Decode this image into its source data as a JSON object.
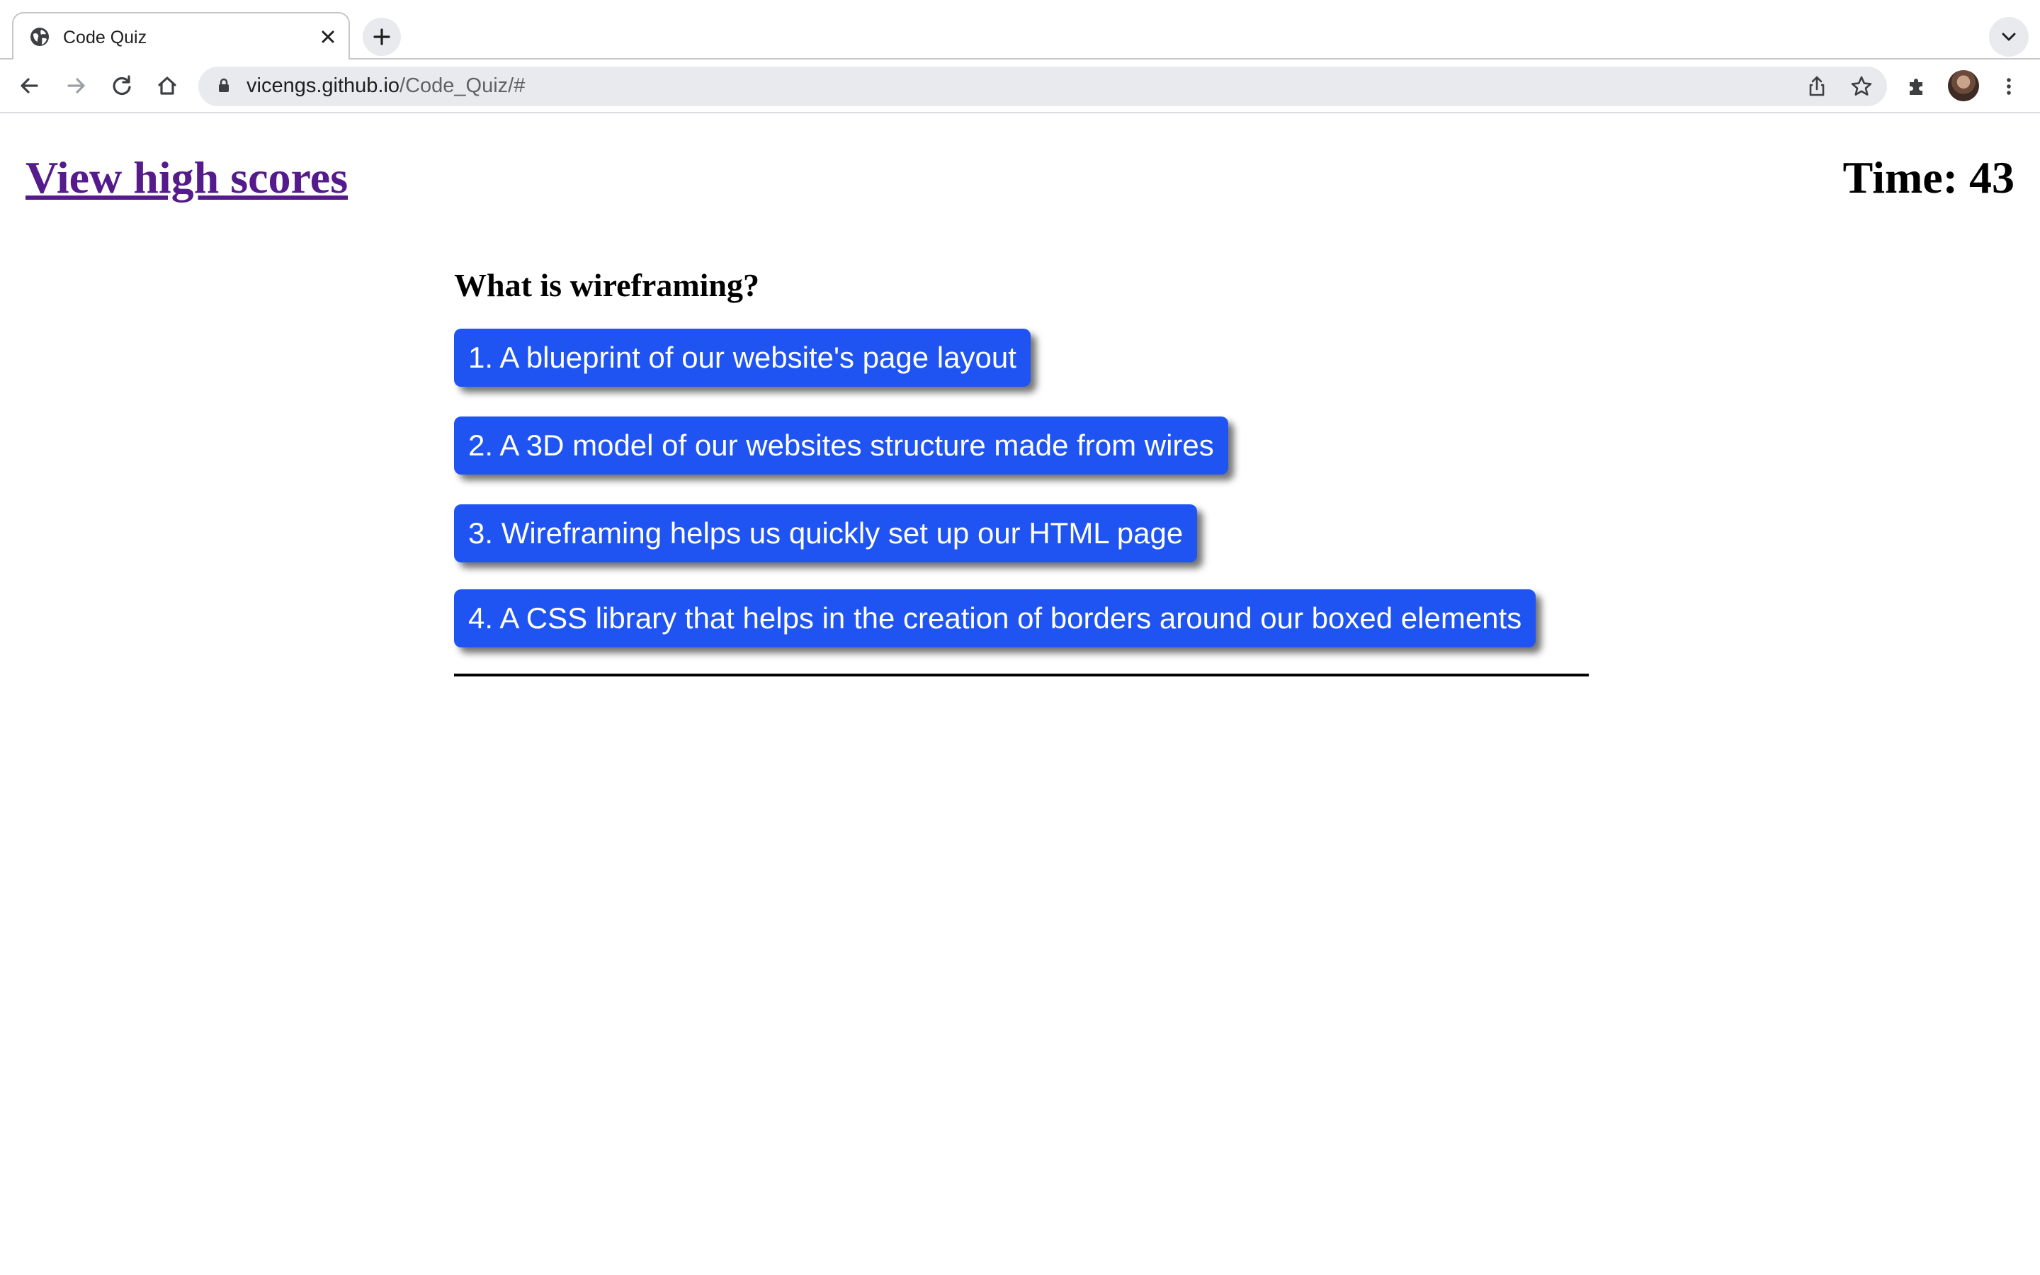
{
  "browser": {
    "tab": {
      "title": "Code Quiz"
    },
    "address_bar": {
      "host": "vicengs.github.io",
      "path": "/Code_Quiz/#"
    }
  },
  "page": {
    "high_scores_link": "View high scores",
    "timer": {
      "label": "Time: 43",
      "seconds_remaining": 43
    },
    "quiz": {
      "question": "What is wireframing?",
      "answers": [
        "1. A blueprint of our website's page layout",
        "2. A 3D model of our websites structure made from wires",
        "3. Wireframing helps us quickly set up our HTML page",
        "4. A CSS library that helps in the creation of borders around our boxed elements"
      ]
    }
  },
  "colors": {
    "answer_button_bg": "#1f54f2",
    "answer_button_text": "#ffffff",
    "visited_link": "#551a8b"
  },
  "icons": [
    "globe-icon",
    "close-icon",
    "plus-icon",
    "chevron-down-icon",
    "back-arrow-icon",
    "forward-arrow-icon",
    "reload-icon",
    "home-icon",
    "lock-icon",
    "share-icon",
    "star-icon",
    "extensions-icon",
    "more-menu-icon"
  ]
}
